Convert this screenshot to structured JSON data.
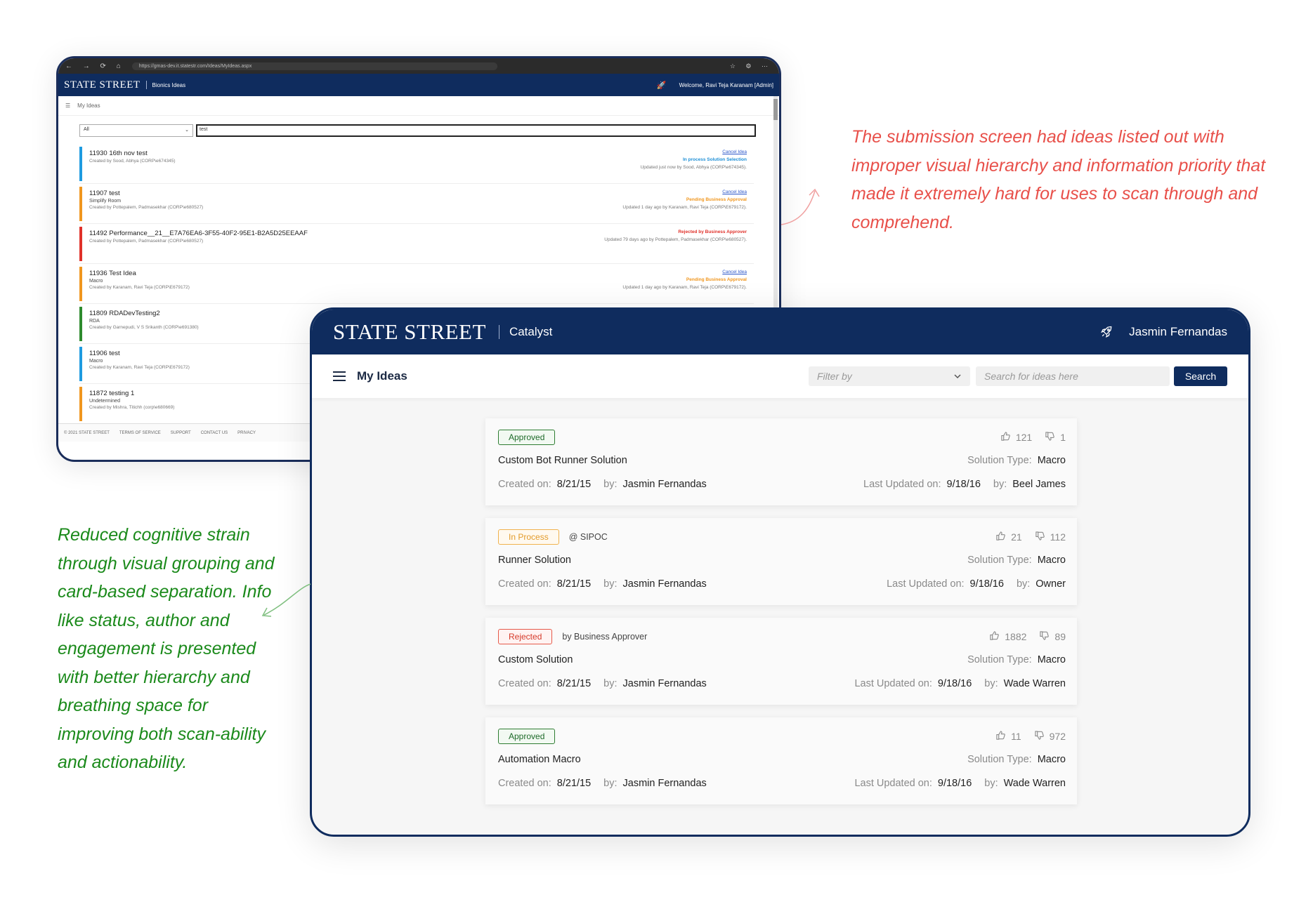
{
  "old_screen": {
    "url": "https://gmas-dev.it.statestr.com/Ideas/MyIdeas.aspx",
    "logo": "STATE STREET",
    "app_name": "Bionics Ideas",
    "welcome": "Welcome, Ravi Teja Karanam [Admin]",
    "page_title": "My Ideas",
    "filter_value": "All",
    "search_value": "test",
    "rows": [
      {
        "title": "11930 16th nov test",
        "subtitle": "",
        "created": "Created by Sood, Abhya (CORP\\e674345)",
        "cancel": "Cancel Idea",
        "status": "In process Solution Selection",
        "status_color": "#1e8fd6",
        "updated": "Updated just now by Sood, Abhya (CORP\\e674345).",
        "bar": "#1e9be0"
      },
      {
        "title": "11907 test",
        "subtitle": "Simplify Room",
        "created": "Created by Pottepalem, Padmasekhar (CORP\\e680527)",
        "cancel": "Cancel Idea",
        "status": "Pending Business Approval",
        "status_color": "#f0961e",
        "updated": "Updated 1 day ago by Karanam, Ravi Teja (CORP\\E679172).",
        "bar": "#f0961e"
      },
      {
        "title": "11492 Performance__21__E7A76EA6-3F55-40F2-95E1-B2A5D25EEAAF",
        "subtitle": "",
        "created": "Created by Pottepalem, Padmasekhar (CORP\\e680527)",
        "cancel": "",
        "status": "Rejected by Business Approver",
        "status_color": "#e0312a",
        "updated": "Updated 79 days ago by Pottepalem, Padmasekhar (CORP\\e680527).",
        "bar": "#e0312a"
      },
      {
        "title": "11936 Test Idea",
        "subtitle": "Macro",
        "created": "Created by Karanam, Ravi Teja (CORP\\E679172)",
        "cancel": "Cancel Idea",
        "status": "Pending Business Approval",
        "status_color": "#f0961e",
        "updated": "Updated 1 day ago by Karanam, Ravi Teja (CORP\\E679172).",
        "bar": "#f0961e"
      },
      {
        "title": "11809 RDADevTesting2",
        "subtitle": "RDA",
        "created": "Created by Garnepudi, V S Srikanth (CORP\\e691380)",
        "cancel": "",
        "status": "",
        "status_color": "#333",
        "updated": "",
        "bar": "#2e8b2e"
      },
      {
        "title": "11906 test",
        "subtitle": "Macro",
        "created": "Created by Karanam, Ravi Teja (CORP\\E679172)",
        "cancel": "",
        "status": "",
        "status_color": "#333",
        "updated": "",
        "bar": "#1e9be0"
      },
      {
        "title": "11872 testing 1",
        "subtitle": "Undetermined",
        "created": "Created by Mishra, Titichh (corp\\e680669)",
        "cancel": "",
        "status": "",
        "status_color": "#333",
        "updated": "",
        "bar": "#f0961e"
      }
    ],
    "footer": [
      "© 2021 STATE STREET",
      "TERMS OF SERVICE",
      "SUPPORT",
      "CONTACT US",
      "PRIVACY"
    ]
  },
  "new_screen": {
    "logo": "STATE STREET",
    "app_name": "Catalyst",
    "user_name": "Jasmin Fernandas",
    "page_title": "My Ideas",
    "filter_placeholder": "Filter by",
    "search_placeholder": "Search for ideas here",
    "search_button": "Search",
    "labels": {
      "solution_type": "Solution Type:",
      "created_on": "Created on:",
      "by": "by:",
      "last_updated_on": "Last Updated on:"
    },
    "cards": [
      {
        "status": "Approved",
        "status_kind": "approved",
        "extra": "",
        "likes": "121",
        "dislikes": "1",
        "title": "Custom Bot Runner Solution",
        "solution_type": "Macro",
        "created_on": "8/21/15",
        "created_by": "Jasmin Fernandas",
        "updated_on": "9/18/16",
        "updated_by": "Beel James"
      },
      {
        "status": "In Process",
        "status_kind": "process",
        "extra": "@ SIPOC",
        "likes": "21",
        "dislikes": "112",
        "title": "Runner Solution",
        "solution_type": "Macro",
        "created_on": "8/21/15",
        "created_by": "Jasmin Fernandas",
        "updated_on": "9/18/16",
        "updated_by": "Owner"
      },
      {
        "status": "Rejected",
        "status_kind": "rejected",
        "extra": "by Business Approver",
        "likes": "1882",
        "dislikes": "89",
        "title": "Custom Solution",
        "solution_type": "Macro",
        "created_on": "8/21/15",
        "created_by": "Jasmin Fernandas",
        "updated_on": "9/18/16",
        "updated_by": "Wade Warren"
      },
      {
        "status": "Approved",
        "status_kind": "approved",
        "extra": "",
        "likes": "11",
        "dislikes": "972",
        "title": "Automation Macro",
        "solution_type": "Macro",
        "created_on": "8/21/15",
        "created_by": "Jasmin Fernandas",
        "updated_on": "9/18/16",
        "updated_by": "Wade Warren"
      }
    ]
  },
  "annotations": {
    "problem": "The submission screen had ideas listed out with improper visual hierarchy and information priority that made it extremely hard for uses to scan through and comprehend.",
    "solution": "Reduced cognitive strain through visual grouping and card-based separation. Info like status, author and engagement is presented with better hierarchy and breathing space for improving both scan-ability and actionability."
  },
  "colors": {
    "navy": "#0f2c5e",
    "problem_text": "#e8504a",
    "solution_text": "#1b8a1b"
  }
}
